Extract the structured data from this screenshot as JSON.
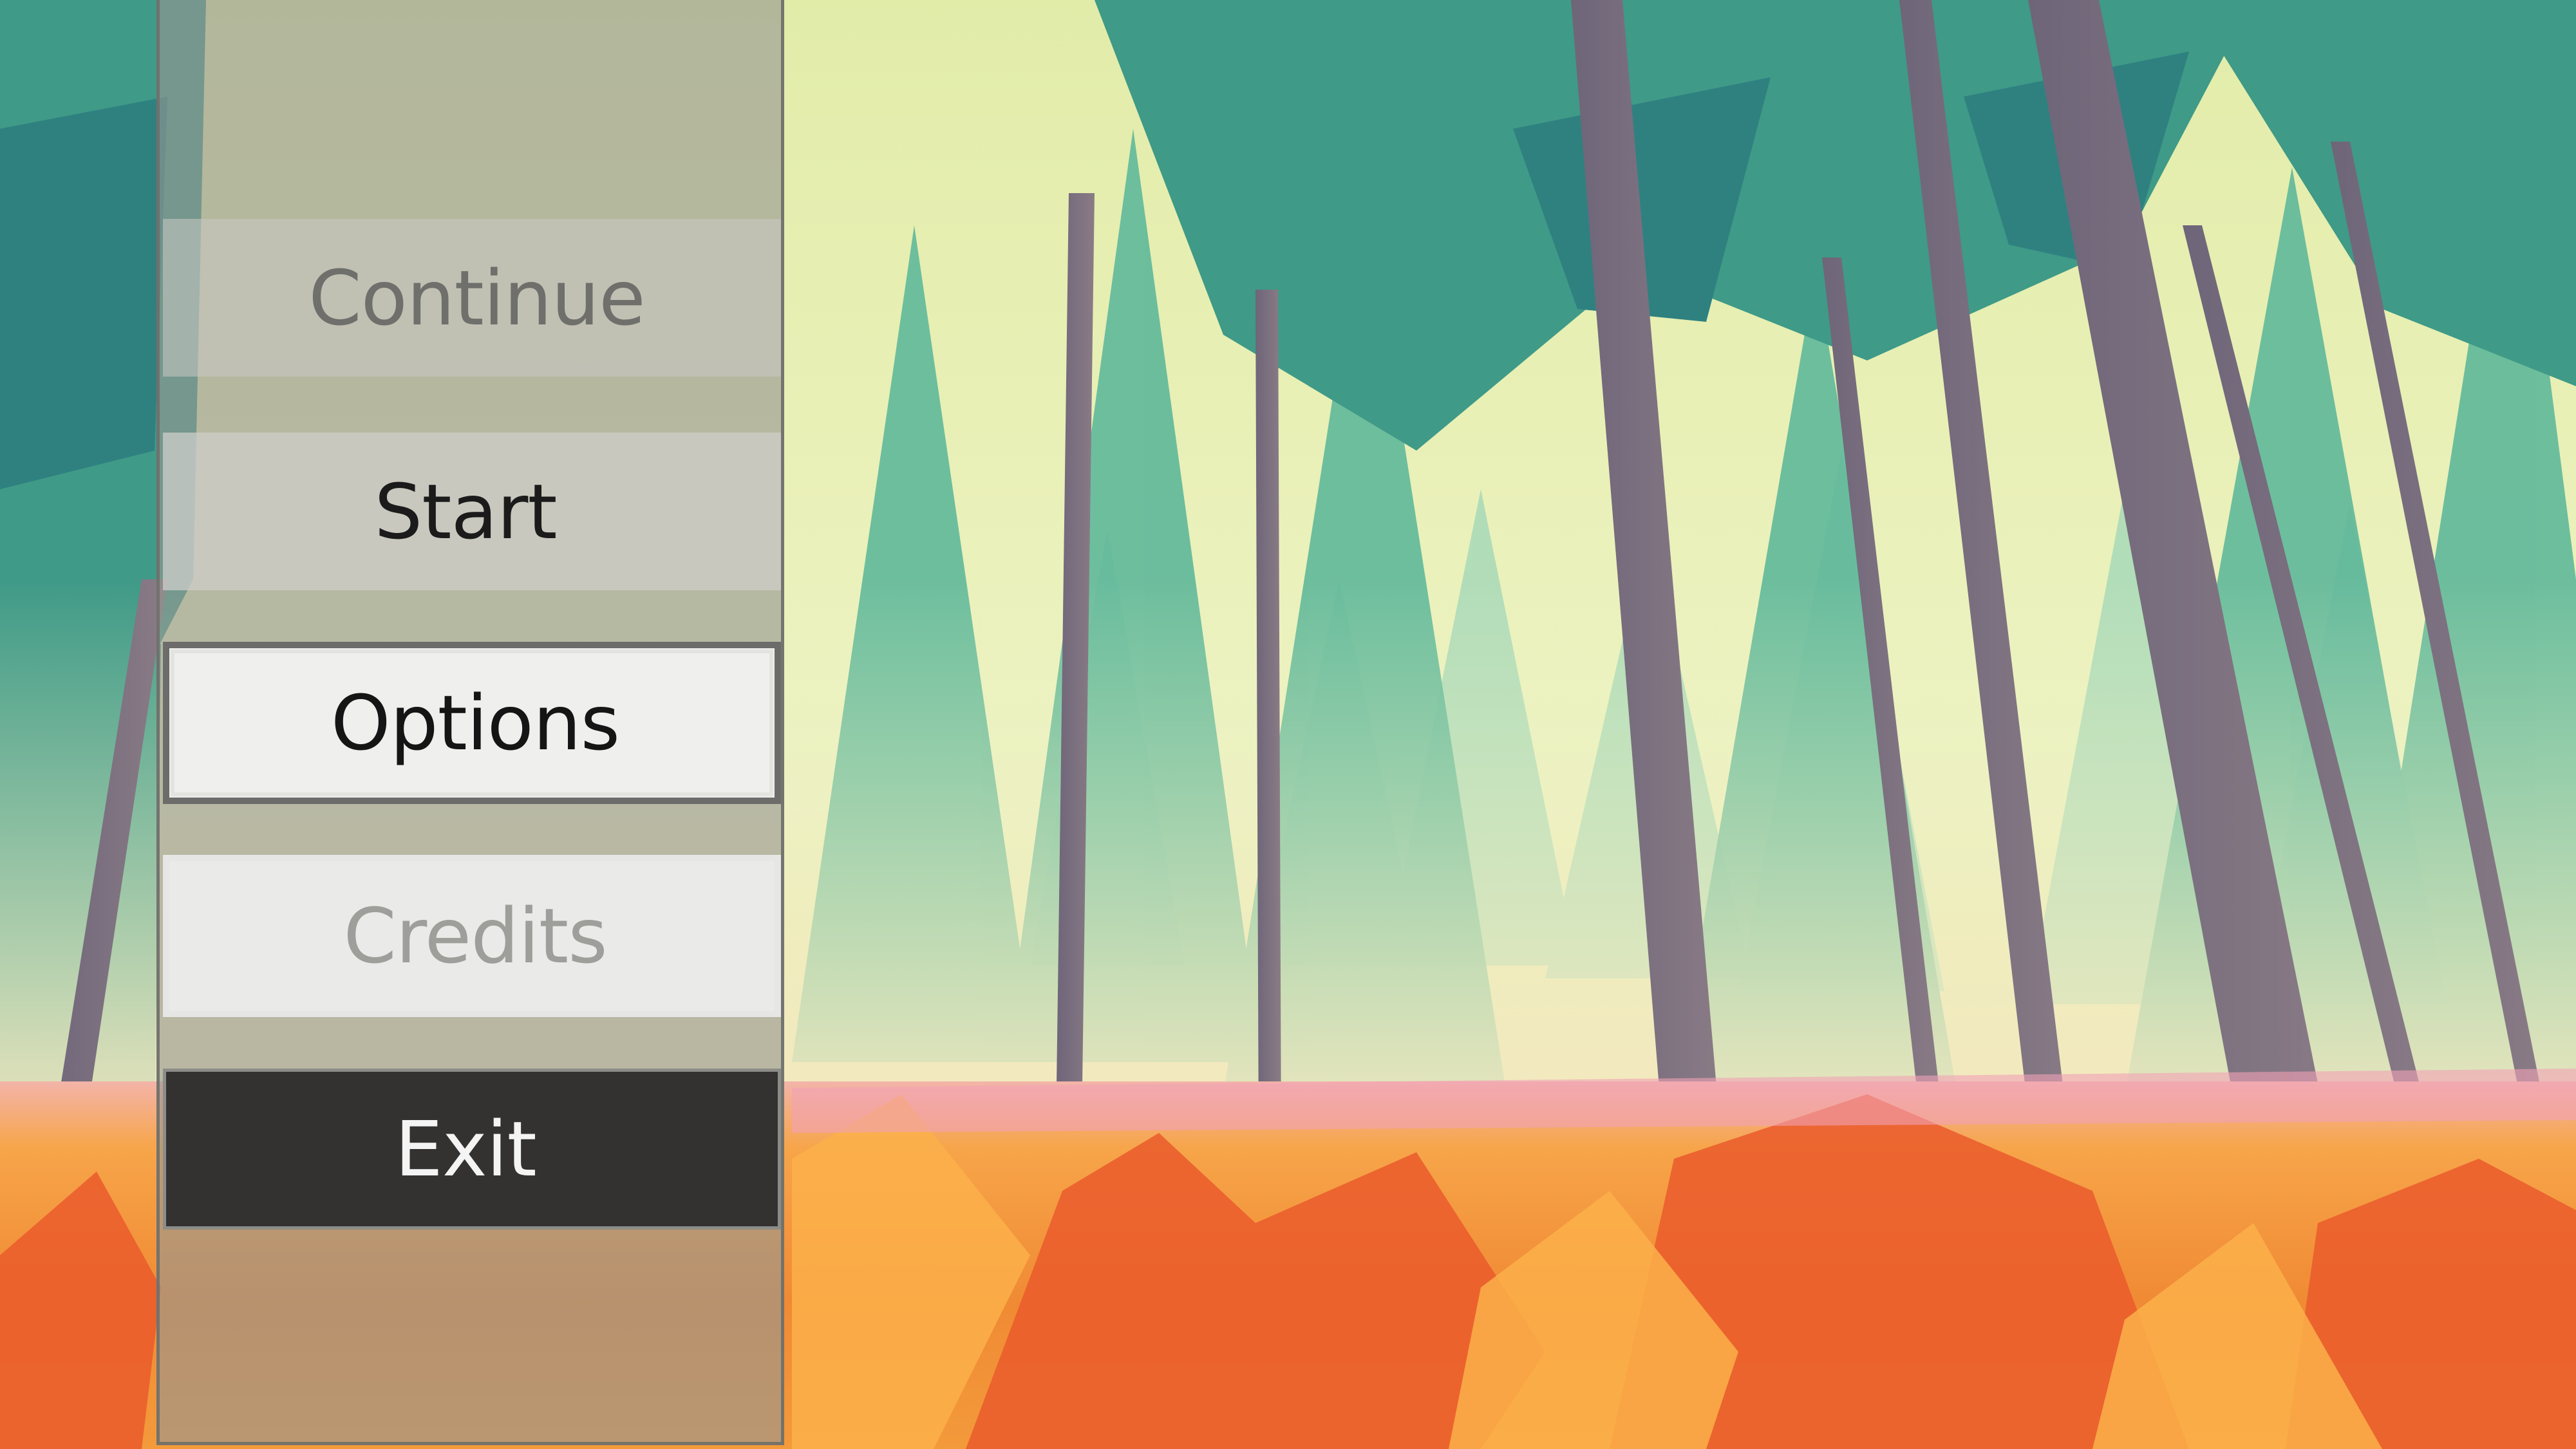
{
  "scene": {
    "type": "game-title-screen",
    "background": "stylized low-poly pine forest with orange grass",
    "colors": {
      "sky": "#e6eeb3",
      "tree_far": "#6fc3a8",
      "tree_mid": "#4aa58f",
      "tree_near": "#2f7f7a",
      "trunk": "#7d6f7f",
      "grass_orange": "#f59a3a",
      "grass_red": "#ea5a2c",
      "grass_pink": "#f0a7b8"
    }
  },
  "menu": {
    "items": [
      {
        "label": "Continue",
        "state": "disabled"
      },
      {
        "label": "Start",
        "state": "normal"
      },
      {
        "label": "Options",
        "state": "highlighted"
      },
      {
        "label": "Credits",
        "state": "disabled"
      },
      {
        "label": "Exit",
        "state": "pressed"
      }
    ]
  }
}
